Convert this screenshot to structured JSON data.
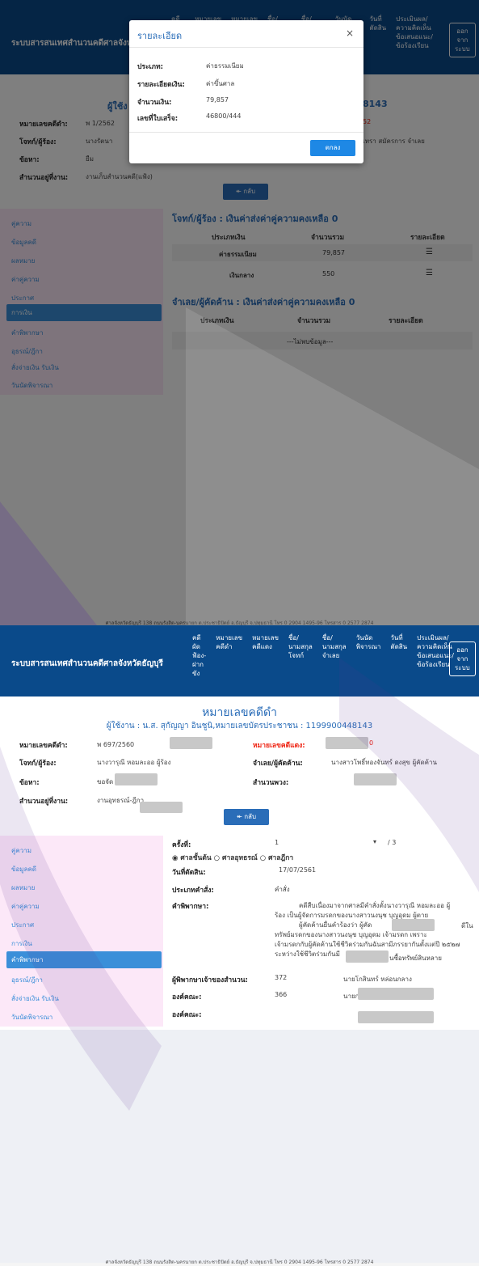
{
  "app": {
    "brand": "ระบบสารสนเทศสำนวนคดีศาลจังหวัดธัญบุรี",
    "brand_short": "ระบบสารสนเทศสำนวนคดีศาลจังหวั",
    "nav": [
      "คดี\nผัด\nฟ้อง-\nฝาก\nขัง",
      "หมายเลข\nคดีดำ",
      "หมายเลข\nคดีแดง",
      "ชื่อ/\nนามสกุล\nโจทก์",
      "ชื่อ/\nนามสกุล\nจำเลย",
      "วันนัด\nพิจารณา",
      "วันที่\nตัดสิน",
      "ประเมินผล/\nความคิดเห็น\nข้อเสนอแนะ/\nข้อร้องเรียน"
    ],
    "logout": "ออก\nจาก\nระบบ"
  },
  "modal": {
    "title": "รายละเอียด",
    "close": "×",
    "rows": [
      {
        "label": "ประเภท:",
        "value": "ค่าธรรมเนียม"
      },
      {
        "label": "รายละเอียดเงิน:",
        "value": "ค่าขึ้นศาล"
      },
      {
        "label": "จำนวนเงิน:",
        "value": "79,857"
      },
      {
        "label": "เลขที่ใบเสร็จ:",
        "value": "46800/444"
      }
    ],
    "ok": "ตกลง"
  },
  "top": {
    "user_line_partial": "ผู้ใช้ง",
    "id_partial": "8143",
    "fields": [
      {
        "label": "หมายเลขคดีดำ:",
        "value": "พ 1/2562"
      },
      {
        "label": "โจทก์/ผู้ร้อง:",
        "value": "นางรัตนา "
      },
      {
        "label": "ข้อหา:",
        "value": "ยืม"
      },
      {
        "label": "สำนวนอยู่ที่งาน:",
        "value": "งานเก็บสำนวนคดี(แฟ้ง)"
      }
    ],
    "red_partial": "52",
    "defendant_partial": "เทรา สมัครการ จำเลย",
    "back": "↞ กลับ",
    "sidebar": [
      "คู่ความ",
      "ข้อมูลคดี",
      "ผลหมาย",
      "ค่าคู่ความ",
      "ประกาศ",
      "การเงิน",
      "คำพิพากษา",
      "อุธรณ์/ฎีกา",
      "สั่งจ่ายเงิน รับเงิน",
      "วันนัดพิจารณา"
    ],
    "active_index": 5,
    "plaintiff_title": "โจทก์/ผู้ร้อง : เงินค่าส่งค่าคู่ความคงเหลือ 0",
    "headers": [
      "ประเภทเงิน",
      "จำนวนรวม",
      "รายละเอียด"
    ],
    "rows": [
      {
        "type": "ค่าธรรมเนียม",
        "amount": "79,857",
        "icon": "list-icon"
      },
      {
        "type": "เงินกลาง",
        "amount": "550",
        "icon": "list-icon"
      }
    ],
    "defendant_title": "จำเลย/ผู้คัดค้าน : เงินค่าส่งค่าคู่ความคงเหลือ 0",
    "no_data": "---ไม่พบข้อมูล---",
    "footer": "ศาลจังหวัดธัญบุรี 138 ถนนรังสิต-นครนายก ต.ประชาธิปัตย์ อ.ธัญบุรี จ.ปทุมธานี โทร 0 2904 1495-96 โทรสาร 0 2577 2874"
  },
  "bottom": {
    "title": "หมายเลขคดีดำ",
    "user_line": "ผู้ใช้งาน : น.ส. สุกัญญา อินชูนิ,หมายเลขบัตรประชาชน : 1199900448143",
    "black_label": "หมายเลขคดีดำ:",
    "black_value": "พ 697/2560",
    "red_label": "หมายเลขคดีแดง:",
    "red_value_partial": "0",
    "plaintiff_label": "โจทก์/ผู้ร้อง:",
    "plaintiff_value": "นางวารุณี หอมละออ ผู้ร้อง",
    "defendant_label": "จำเลย/ผู้คัดค้าน:",
    "defendant_value": "นางสาวโพธิ์ทองจันทร์ ดงสุข ผู้คัดค้าน",
    "charge_label": "ข้อหา:",
    "charge_value": "ขอจัด",
    "pending_label": "สำนวนพวง:",
    "at_label": "สำนวนอยู่ที่งาน:",
    "at_value": "งานอุทธรณ์-ฎีกา",
    "back": "↞ กลับ",
    "sidebar": [
      "คู่ความ",
      "ข้อมูลคดี",
      "ผลหมาย",
      "ค่าคู่ความ",
      "ประกาศ",
      "การเงิน",
      "คำพิพากษา",
      "อุธรณ์/ฎีกา",
      "สั่งจ่ายเงิน รับเงิน",
      "วันนัดพิจารณา"
    ],
    "active_index": 6,
    "times_label": "ครั้งที่:",
    "times_value": "1",
    "times_total": "/ 3",
    "court_options": [
      "ศาลชั้นต้น",
      "ศาลอุทธรณ์",
      "ศาลฎีกา"
    ],
    "judged_date_label": "วันที่ตัดสิน:",
    "judged_date": "17/07/2561",
    "order_type_label": "ประเภทคำสั่ง:",
    "order_type": "คำสั่ง",
    "verdict_label": "คำพิพากษา:",
    "verdict_lines": [
      "คดีสืบเนื่องมาจากศาลมีคำสั่งตั้งนางวารุณี  หอมละออ ผู้",
      "ร้อง เป็นผู้จัดการมรดกของนางสาวนงนุช  บุญอุดม ผู้ตาย",
      "ผู้คัดค้านยื่นคำร้องว่า ผู้คัด",
      "ทรัพย์มรดกของนางสาวนงนุช      บุญอุดม  เจ้ามรดก เพราะ",
      "เจ้ามรดกกับผู้คัดค้านใช้ชีวิตร่วมกันฉันสามีภรรยากันตั้งแต่ปี ๒๕๒๗",
      "ระหว่างใช้ชีวิตร่วมกันมี"
    ],
    "verdict_tail_right": "ดีใน",
    "verdict_tail_last": "นซื้อทรัพย์สินหลาย",
    "judge_label": "ผู้พิพากษาเจ้าของสำนวน:",
    "judge_num": "372",
    "judge_name": "นายโกสินทร์ หล่อนกลาง",
    "panel_label": "องค์คณะ:",
    "panel_num": "366",
    "panel_name_partial": "นายก",
    "panel2_label": "องค์คณะ:",
    "footer": "ศาลจังหวัดธัญบุรี 138 ถนนรังสิต-นครนายก ต.ประชาธิปัตย์ อ.ธัญบุรี จ.ปทุมธานี โทร 0 2904 1495-96 โทรสาร 0 2577 2874"
  }
}
